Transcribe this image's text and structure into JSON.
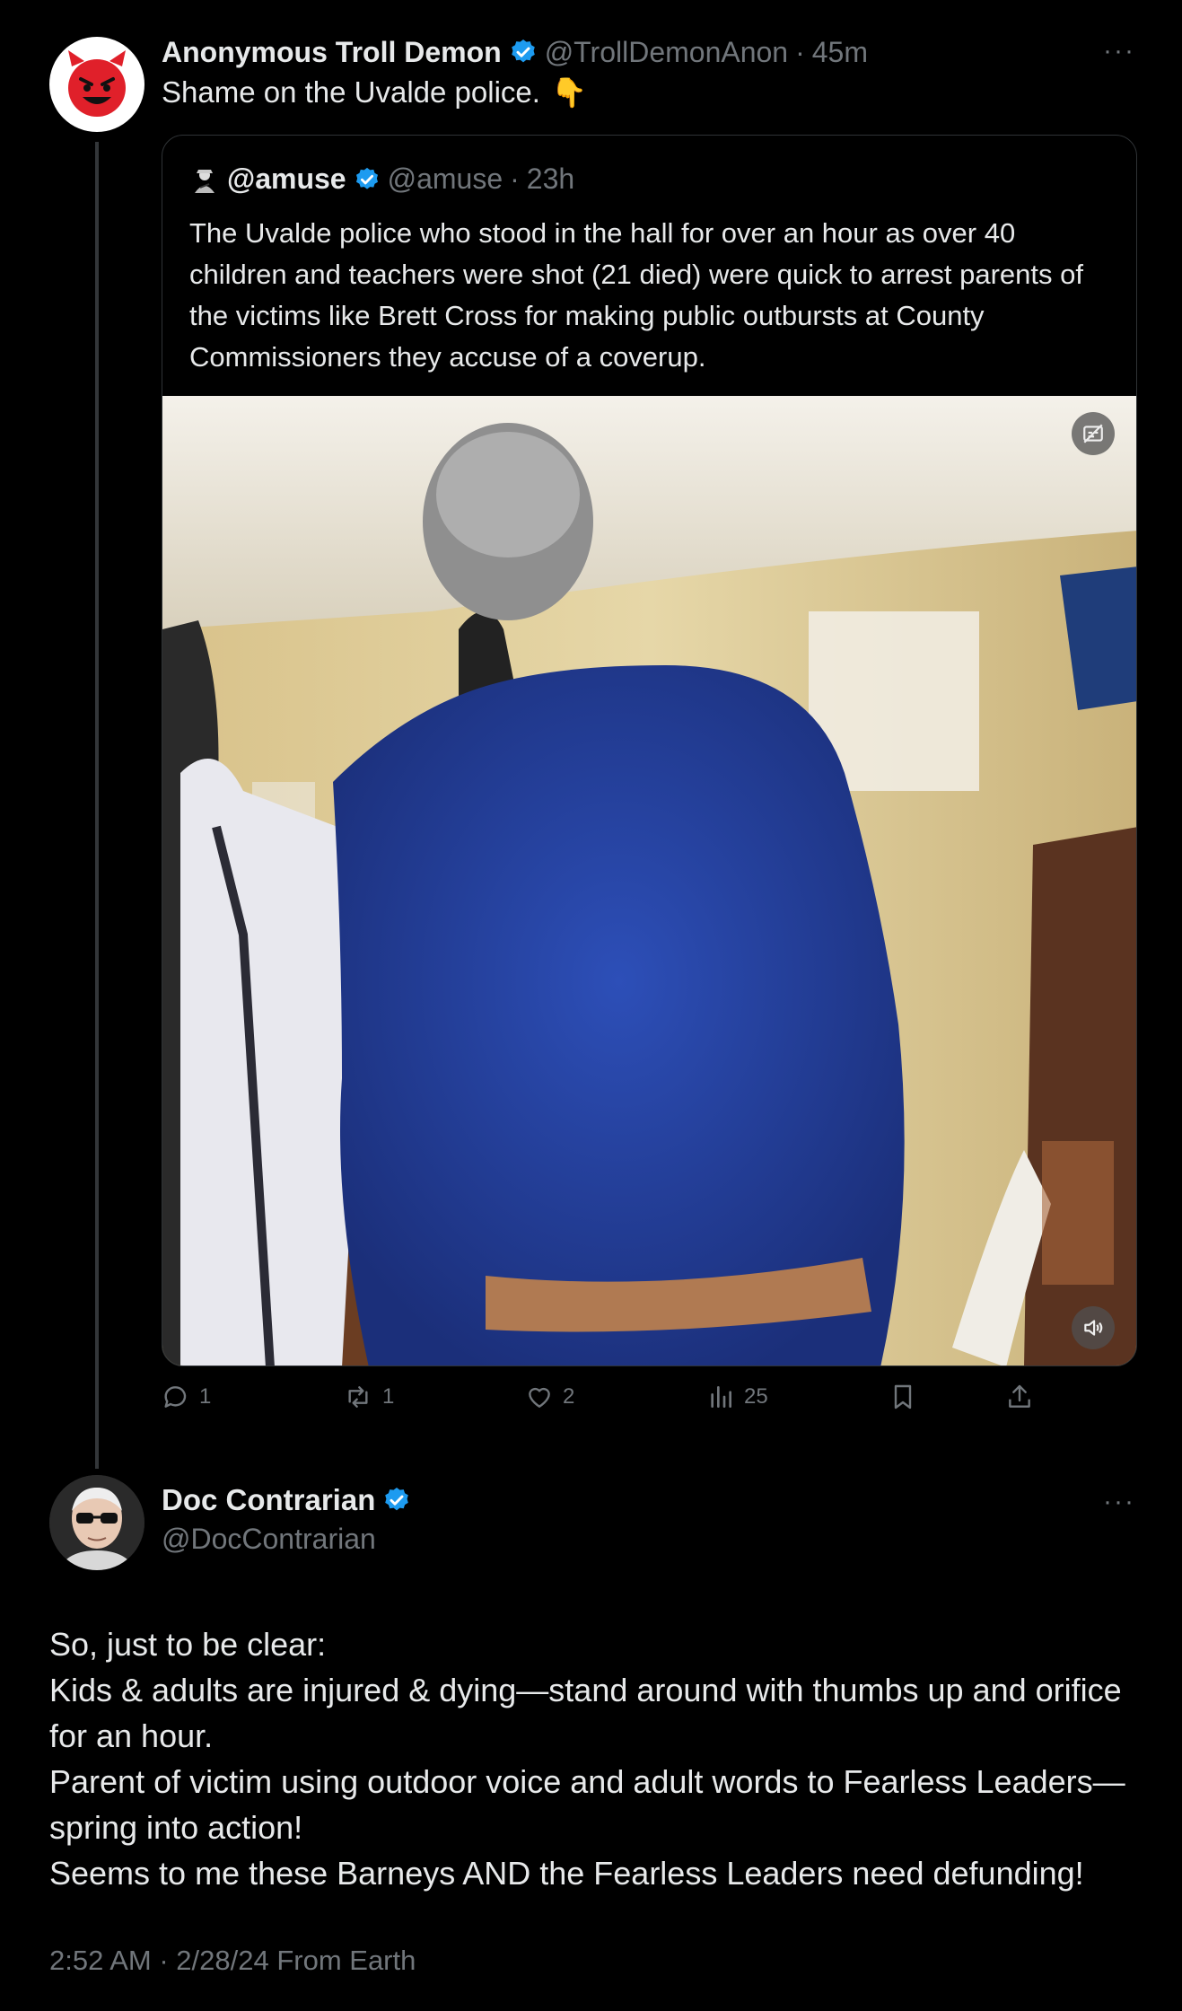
{
  "tweet1": {
    "avatar_icon": "devil-face-icon",
    "display_name": "Anonymous Troll Demon",
    "handle": "@TrollDemonAnon",
    "separator": "·",
    "time": "45m",
    "more": "···",
    "text": "Shame on the Uvalde police.",
    "emoji": "👇",
    "quote": {
      "display_name": "@amuse",
      "handle": "@amuse",
      "separator": "·",
      "time": "23h",
      "text": "The Uvalde police who stood in the hall for over an hour as over 40 children and teachers were shot (21 died) were quick to arrest parents of the victims like Brett Cross for making public outbursts at County Commissioners they accuse of a coverup.",
      "media_icons": [
        "captions-off-icon",
        "volume-icon"
      ]
    },
    "actions": {
      "replies": "1",
      "reposts": "1",
      "likes": "2",
      "views": "25"
    }
  },
  "tweet2": {
    "display_name": "Doc Contrarian",
    "handle": "@DocContrarian",
    "more": "···",
    "lines": [
      "So, just to be clear:",
      "Kids & adults are injured & dying—stand around with thumbs up and orifice for an hour.",
      "Parent of victim using outdoor voice and adult words to Fearless Leaders—spring into action!",
      "Seems to me these Barneys AND the Fearless Leaders need defunding!"
    ],
    "meta": "2:52 AM · 2/28/24 From Earth"
  },
  "colors": {
    "background": "#000000",
    "text": "#e7e9ea",
    "muted": "#71767b",
    "verified": "#1d9bf0",
    "border": "#2f3336"
  }
}
